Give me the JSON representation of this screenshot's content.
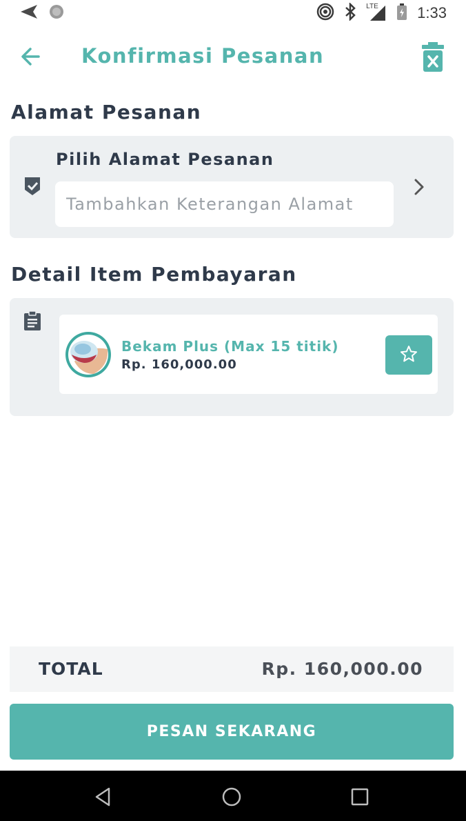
{
  "status_bar": {
    "time": "1:33",
    "network": "LTE",
    "icons": [
      "send-icon",
      "circle-dot-icon",
      "hotspot-icon",
      "bluetooth-icon",
      "signal-icon",
      "battery-icon"
    ]
  },
  "app_bar": {
    "title": "Konfirmasi Pesanan",
    "icons": [
      "back-arrow-icon",
      "trash-icon"
    ]
  },
  "address_section": {
    "title": "Alamat Pesanan",
    "select_label": "Pilih Alamat Pesanan",
    "input_value": "",
    "input_placeholder": "Tambahkan Keterangan Alamat",
    "icons": [
      "check-shield-icon",
      "chevron-right-icon"
    ]
  },
  "payment_section": {
    "title": "Detail Item Pembayaran",
    "items": [
      {
        "name": "Bekam Plus (Max 15 titik)",
        "price": "Rp. 160,000.00",
        "icons": [
          "bekam-product-icon",
          "star-outline-icon"
        ]
      }
    ],
    "icons": [
      "clipboard-icon"
    ]
  },
  "total": {
    "label": "TOTAL",
    "value": "Rp. 160,000.00"
  },
  "order_button": {
    "label": "PESAN SEKARANG"
  },
  "nav_bar": {
    "icons": [
      "nav-back-icon",
      "nav-home-icon",
      "nav-recents-icon"
    ]
  },
  "colors": {
    "accent": "#55b5ad",
    "text_dark": "#2f3a4a",
    "card_bg": "#edf0f2",
    "nav_bar": "#000000"
  }
}
